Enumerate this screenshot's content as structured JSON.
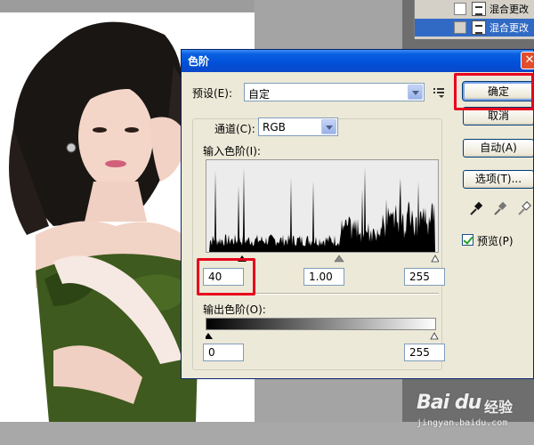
{
  "layers": [
    {
      "name": "混合更改"
    },
    {
      "name": "混合更改"
    }
  ],
  "dialog": {
    "title": "色阶",
    "preset_label": "预设(E):",
    "preset_value": "自定",
    "channel_label": "通道(C):",
    "channel_value": "RGB",
    "input_levels_label": "输入色阶(I):",
    "input_black": "40",
    "input_gamma": "1.00",
    "input_white": "255",
    "output_levels_label": "输出色阶(O):",
    "output_black": "0",
    "output_white": "255",
    "buttons": {
      "ok": "确定",
      "cancel": "取消",
      "auto": "自动(A)",
      "options": "选项(T)..."
    },
    "preview_label": "预览(P)",
    "preview_checked": true,
    "close_glyph": "✕"
  },
  "watermark": {
    "logo": "Bai du",
    "sub": "经验",
    "url": "jingyan.baidu.com"
  },
  "colors": {
    "title_bar": "#0050d8",
    "highlight_red": "#e8001c",
    "dress_green": "#3e5a1e"
  },
  "icons": [
    "close-icon",
    "dropdown-arrow-icon",
    "menu-options-icon",
    "eyedropper-icon",
    "checkbox-icon"
  ]
}
